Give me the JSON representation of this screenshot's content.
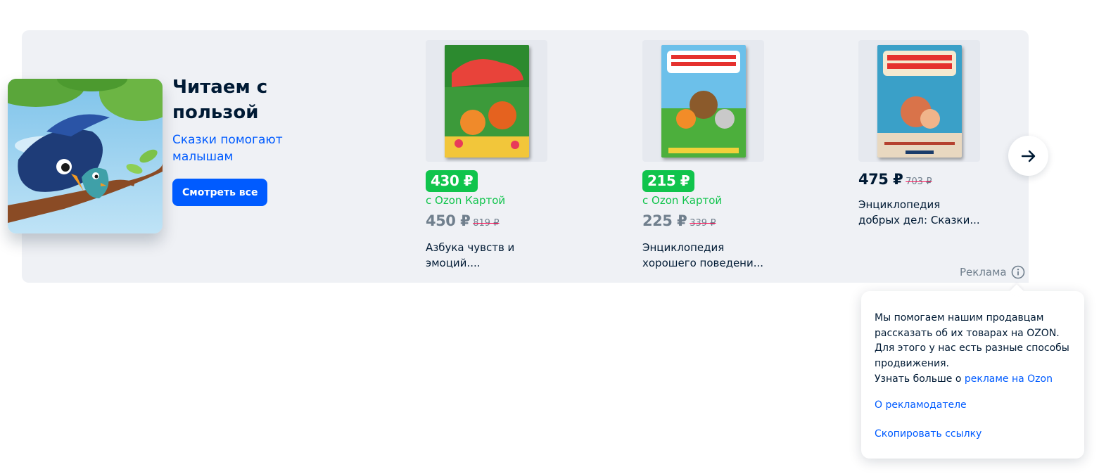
{
  "promo": {
    "title": "Читаем с пользой",
    "subtitle": "Сказки помогают малышам",
    "button_label": "Смотреть все"
  },
  "products": [
    {
      "badge_price": "430 ₽",
      "card_label": "с Ozon Картой",
      "price": "450 ₽",
      "old_price": "819 ₽",
      "title": "Азбука чувств и эмоций...."
    },
    {
      "badge_price": "215 ₽",
      "card_label": "с Ozon Картой",
      "price": "225 ₽",
      "old_price": "339 ₽",
      "title": "Энциклопедия хорошего поведени..."
    },
    {
      "price": "475 ₽",
      "old_price": "703 ₽",
      "title": "Энциклопедия добрых дел: Сказки..."
    }
  ],
  "ad": {
    "label": "Реклама",
    "popup_text": "Мы помогаем нашим продавцам рассказать об их товарах на OZON. Для этого у нас есть разные способы продвижения.",
    "learn_more_prefix": "Узнать больше о",
    "learn_more_link": "рекламе на Ozon",
    "about_advertiser": "О рекламодателе",
    "copy_link": "Скопировать ссылку"
  },
  "colors": {
    "accent_blue": "#005bff",
    "green": "#10c44c",
    "banner_bg": "#eff1f5",
    "text_dark": "#001a34",
    "text_grey": "#707f8d",
    "strike_red": "#f91155"
  },
  "icons": {
    "next": "arrow-right-icon",
    "info": "info-icon"
  }
}
